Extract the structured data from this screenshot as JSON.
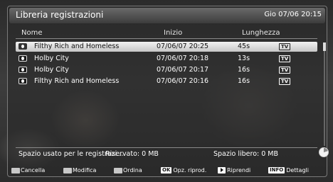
{
  "header": {
    "title": "Libreria registrazioni",
    "datetime": "Gio 07/06 20:15"
  },
  "columns": {
    "name": "Nome",
    "start": "Inizio",
    "length": "Lunghezza"
  },
  "recordings": [
    {
      "name": "Filthy Rich and Homeless",
      "start": "07/06/07  20:25",
      "length": "45s",
      "source": "TV",
      "selected": true
    },
    {
      "name": "Holby City",
      "start": "07/06/07  20:18",
      "length": "13s",
      "source": "TV",
      "selected": false
    },
    {
      "name": "Holby City",
      "start": "07/06/07  20:17",
      "length": "16s",
      "source": "TV",
      "selected": false
    },
    {
      "name": "Filthy Rich and Homeless",
      "start": "07/06/07  20:16",
      "length": "16s",
      "source": "TV",
      "selected": false
    }
  ],
  "status": {
    "used": "Spazio usato per le registrazi...",
    "reserved": "Riservato: 0 MB",
    "free": "Spazio libero: 0 MB"
  },
  "legend": [
    {
      "key": "red",
      "label": "Cancella",
      "color": "#c8c8c8"
    },
    {
      "key": "green",
      "label": "Modifica",
      "color": "#c8c8c8"
    },
    {
      "key": "yellow",
      "label": "Ordina",
      "color": "#c8c8c8"
    },
    {
      "key": "OK",
      "label": "Opz. riprod."
    },
    {
      "key": "play",
      "label": "Riprendi"
    },
    {
      "key": "INFO",
      "label": "Dettagli"
    }
  ],
  "icons": {
    "recording": "eye-icon",
    "source": "tv-badge-icon",
    "disk": "disk-usage-icon"
  }
}
